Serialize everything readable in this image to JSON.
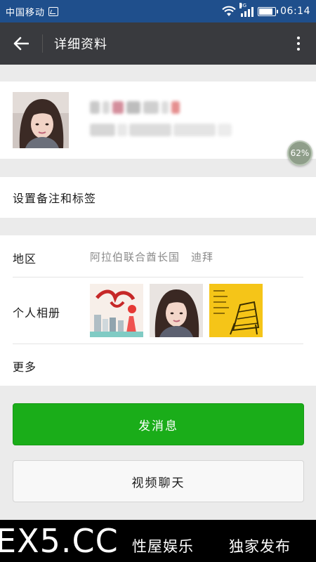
{
  "status_bar": {
    "carrier": "中国移动",
    "network_tag": "3G",
    "battery_level": 0.85,
    "time": "06:14"
  },
  "app_bar": {
    "title": "详细资料",
    "back_icon": "arrow-left-icon",
    "more_icon": "more-vertical-icon"
  },
  "profile": {
    "avatar_icon": "user-photo",
    "name_redacted": true,
    "wechat_id_redacted": true
  },
  "floating_badge": {
    "label": "62%"
  },
  "remark": {
    "label": "设置备注和标签"
  },
  "details": {
    "region_label": "地区",
    "region_value": "阿拉伯联合酋长国　迪拜",
    "album_label": "个人相册",
    "album_photo_count": 3,
    "more_label": "更多"
  },
  "actions": {
    "send_message": "发消息",
    "video_chat": "视频聊天"
  },
  "footer": {
    "logo": "EX5.CC",
    "link1": "性屋娱乐",
    "link2": "独家发布"
  },
  "colors": {
    "status_bar": "#1f4f8c",
    "app_bar": "#393a3e",
    "primary_green": "#1aad19",
    "background": "#ebebeb"
  }
}
